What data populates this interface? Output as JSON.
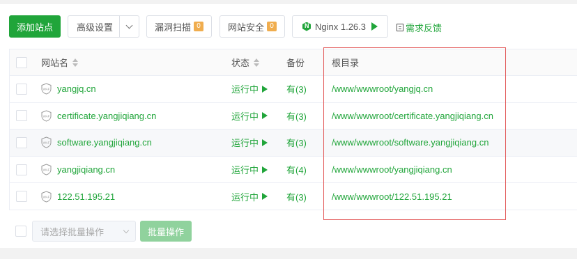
{
  "toolbar": {
    "add_site": "添加站点",
    "advanced": "高级设置",
    "vuln_scan": "漏洞扫描",
    "vuln_scan_count": "0",
    "site_security": "网站安全",
    "site_security_count": "0",
    "nginx": "Nginx 1.26.3",
    "feedback": "需求反馈"
  },
  "table": {
    "columns": {
      "name": "网站名",
      "status": "状态",
      "backup": "备份",
      "root": "根目录"
    },
    "rows": [
      {
        "name": "yangjq.cn",
        "status": "运行中",
        "backup": "有(3)",
        "root": "/www/wwwroot/yangjq.cn"
      },
      {
        "name": "certificate.yangjiqiang.cn",
        "status": "运行中",
        "backup": "有(3)",
        "root": "/www/wwwroot/certificate.yangjiqiang.cn"
      },
      {
        "name": "software.yangjiqiang.cn",
        "status": "运行中",
        "backup": "有(3)",
        "root": "/www/wwwroot/software.yangjiqiang.cn"
      },
      {
        "name": "yangjiqiang.cn",
        "status": "运行中",
        "backup": "有(4)",
        "root": "/www/wwwroot/yangjiqiang.cn"
      },
      {
        "name": "122.51.195.21",
        "status": "运行中",
        "backup": "有(3)",
        "root": "/www/wwwroot/122.51.195.21"
      }
    ]
  },
  "footer": {
    "batch_placeholder": "请选择批量操作",
    "batch_button": "批量操作"
  },
  "icons": {
    "waf": "WAF"
  },
  "colors": {
    "accent": "#20a53a",
    "badge": "#f0ad4e",
    "highlight_box": "#e35d5d"
  }
}
